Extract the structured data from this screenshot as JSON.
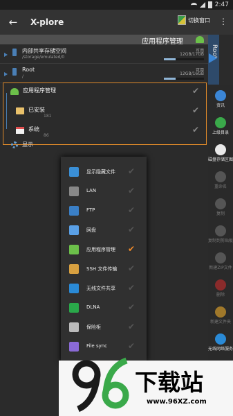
{
  "status_bar": {
    "time": "2:47"
  },
  "app_bar": {
    "title": "X-plore",
    "switch_window": "切换窗口"
  },
  "pane": {
    "header_title": "应用程序管理",
    "tab_label": "Root"
  },
  "volumes": [
    {
      "name": "内部共享存储空间",
      "path": "/storage/emulated/0",
      "free_label": "可用",
      "size": "12GB/17GB",
      "usage": 0.3
    },
    {
      "name": "Root",
      "path": "/",
      "free_label": "可用",
      "size": "12GB/16GB",
      "usage": 0.3
    }
  ],
  "tree": [
    {
      "label": "应用程序管理",
      "sub": ""
    },
    {
      "label": "已安装",
      "sub": "181"
    },
    {
      "label": "系统",
      "sub": "86"
    }
  ],
  "show_label": "显示",
  "toolbar": [
    {
      "label": "资讯",
      "icon": "info-icon",
      "color": "#3b86d6",
      "dim": false
    },
    {
      "label": "上级目录",
      "icon": "up-arrow-icon",
      "color": "#3aa94a",
      "dim": false
    },
    {
      "label": "磁盘存储区图",
      "icon": "pie-chart-icon",
      "color": "#e9e9e9",
      "dim": false
    },
    {
      "label": "重命名",
      "icon": "rename-icon",
      "color": "#555555",
      "dim": true
    },
    {
      "label": "复制",
      "icon": "copy-icon",
      "color": "#555555",
      "dim": true
    },
    {
      "label": "复制到剪贴板",
      "icon": "clipboard-icon",
      "color": "#555555",
      "dim": true
    },
    {
      "label": "新建ZIP文件",
      "icon": "zip-icon",
      "color": "#555555",
      "dim": true
    },
    {
      "label": "删除",
      "icon": "trash-icon",
      "color": "#8a2b2b",
      "dim": true
    },
    {
      "label": "新建文件夹",
      "icon": "new-folder-icon",
      "color": "#a0782a",
      "dim": true
    },
    {
      "label": "无线网络服务",
      "icon": "wifi-icon",
      "color": "#2a8ad6",
      "dim": false
    }
  ],
  "menu": [
    {
      "label": "显示隐藏文件",
      "icon": "eye-icon",
      "color": "#3a8fd6",
      "checked": false
    },
    {
      "label": "LAN",
      "icon": "lan-icon",
      "color": "#888888",
      "checked": false
    },
    {
      "label": "FTP",
      "icon": "ftp-icon",
      "color": "#3a7fc6",
      "checked": false
    },
    {
      "label": "网盘",
      "icon": "cloud-icon",
      "color": "#5aa0e6",
      "checked": false
    },
    {
      "label": "应用程序管理",
      "icon": "android-icon",
      "color": "#6cc04a",
      "checked": true
    },
    {
      "label": "SSH 文件传输",
      "icon": "ssh-icon",
      "color": "#d8a040",
      "checked": false
    },
    {
      "label": "无线文件共享",
      "icon": "wifi-share-icon",
      "color": "#2a8ad6",
      "checked": false
    },
    {
      "label": "DLNA",
      "icon": "dlna-icon",
      "color": "#2aa84a",
      "checked": false
    },
    {
      "label": "保险柜",
      "icon": "vault-icon",
      "color": "#bbbbbb",
      "checked": false
    },
    {
      "label": "File sync",
      "icon": "sync-icon",
      "color": "#8a6ad6",
      "checked": false
    }
  ],
  "watermark": {
    "logo": "96",
    "text": "下载站",
    "url": "www.96XZ.com"
  }
}
